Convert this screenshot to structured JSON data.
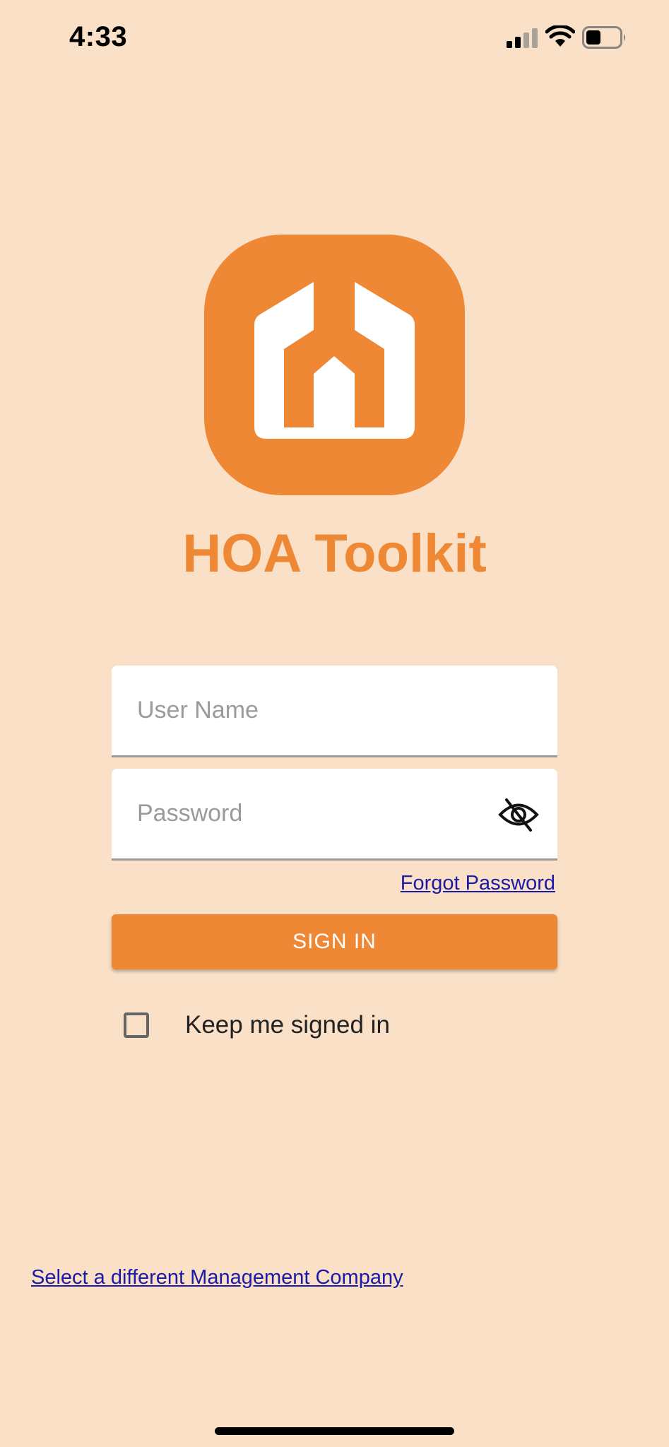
{
  "status_bar": {
    "time": "4:33",
    "icons": [
      "signal-icon",
      "wifi-icon",
      "battery-icon"
    ]
  },
  "app": {
    "logo_icon": "hoa-toolkit-logo",
    "title": "HOA Toolkit",
    "brand_color": "#ef8834",
    "background_color": "#f9e0c6",
    "link_color": "#1b1ba8"
  },
  "login": {
    "username_placeholder": "User Name",
    "username_value": "",
    "password_placeholder": "Password",
    "password_value": "",
    "password_toggle_icon": "eye-slash-icon",
    "forgot_password": "Forgot Password",
    "sign_in": "SIGN IN",
    "keep_signed_in_label": "Keep me signed in",
    "keep_signed_in_checked": false
  },
  "footer": {
    "change_company": "Select a different Management Company"
  }
}
